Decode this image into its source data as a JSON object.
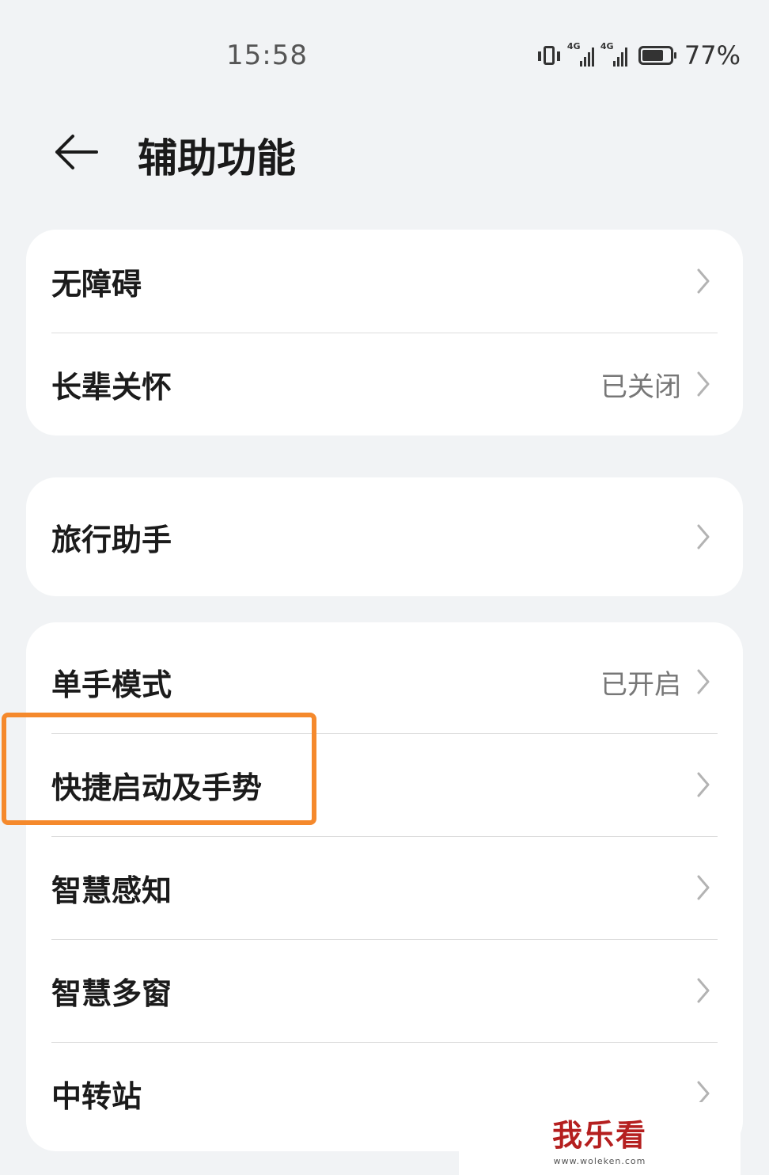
{
  "status_bar": {
    "time": "15:58",
    "network_1": "4G",
    "network_2": "4G",
    "battery_level": 0.77,
    "battery_text": "77%"
  },
  "header": {
    "back_icon": "arrow-left-icon",
    "title": "辅助功能"
  },
  "groups": [
    {
      "items": [
        {
          "label": "无障碍",
          "value": ""
        },
        {
          "label": "长辈关怀",
          "value": "已关闭"
        }
      ]
    },
    {
      "items": [
        {
          "label": "旅行助手",
          "value": ""
        }
      ]
    },
    {
      "items": [
        {
          "label": "单手模式",
          "value": "已开启"
        },
        {
          "label": "快捷启动及手势",
          "value": ""
        },
        {
          "label": "智慧感知",
          "value": ""
        },
        {
          "label": "智慧多窗",
          "value": ""
        },
        {
          "label": "中转站",
          "value": ""
        }
      ]
    }
  ],
  "highlight_color": "#f5892c",
  "watermark": {
    "logo": "我乐看",
    "url": "www.woleken.com"
  }
}
